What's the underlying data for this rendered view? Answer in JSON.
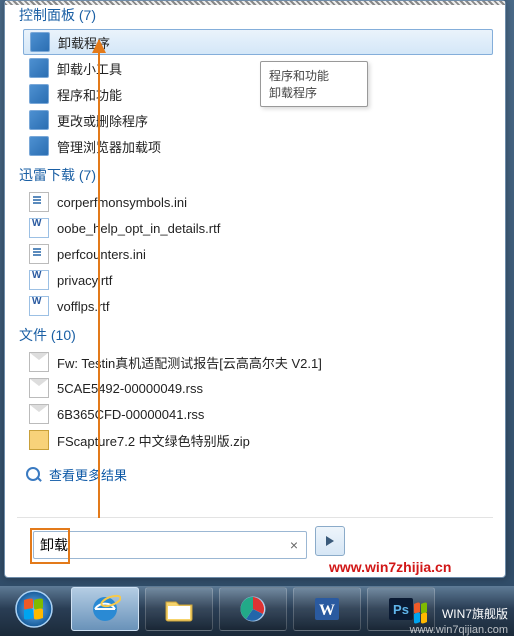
{
  "sections": {
    "control_panel": {
      "header": "控制面板 (7)",
      "selected_index": 0,
      "items": [
        {
          "label": "卸载程序",
          "icon": "win-cp"
        },
        {
          "label": "卸载小工具",
          "icon": "win-cp"
        },
        {
          "label": "程序和功能",
          "icon": "win-cp"
        },
        {
          "label": "更改或删除程序",
          "icon": "win-cp"
        },
        {
          "label": "管理浏览器加载项",
          "icon": "win-cp"
        }
      ]
    },
    "xunlei": {
      "header": "迅雷下载 (7)",
      "items": [
        {
          "label": "corperfmonsymbols.ini",
          "icon": "file-ini"
        },
        {
          "label": "oobe_help_opt_in_details.rtf",
          "icon": "file-rtf"
        },
        {
          "label": "perfcounters.ini",
          "icon": "file-ini"
        },
        {
          "label": "privacy.rtf",
          "icon": "file-rtf"
        },
        {
          "label": "vofflps.rtf",
          "icon": "file-rtf"
        }
      ]
    },
    "files": {
      "header": "文件 (10)",
      "items": [
        {
          "label": "Fw: Testin真机适配测试报告[云高高尔夫 V2.1]",
          "icon": "mail"
        },
        {
          "label": "5CAE5492-00000049.rss",
          "icon": "mail"
        },
        {
          "label": "6B365CFD-00000041.rss",
          "icon": "mail"
        },
        {
          "label": "FScapture7.2 中文绿色特别版.zip",
          "icon": "file-zip"
        }
      ]
    }
  },
  "tooltip": {
    "line1": "程序和功能",
    "line2": "卸载程序"
  },
  "more_results": "查看更多结果",
  "search": {
    "value": "卸载",
    "placeholder": ""
  },
  "watermarks": {
    "site1": "www.win7zhijia.cn",
    "site2": "www.win7qijian.com"
  },
  "brand": "WIN7旗舰版"
}
